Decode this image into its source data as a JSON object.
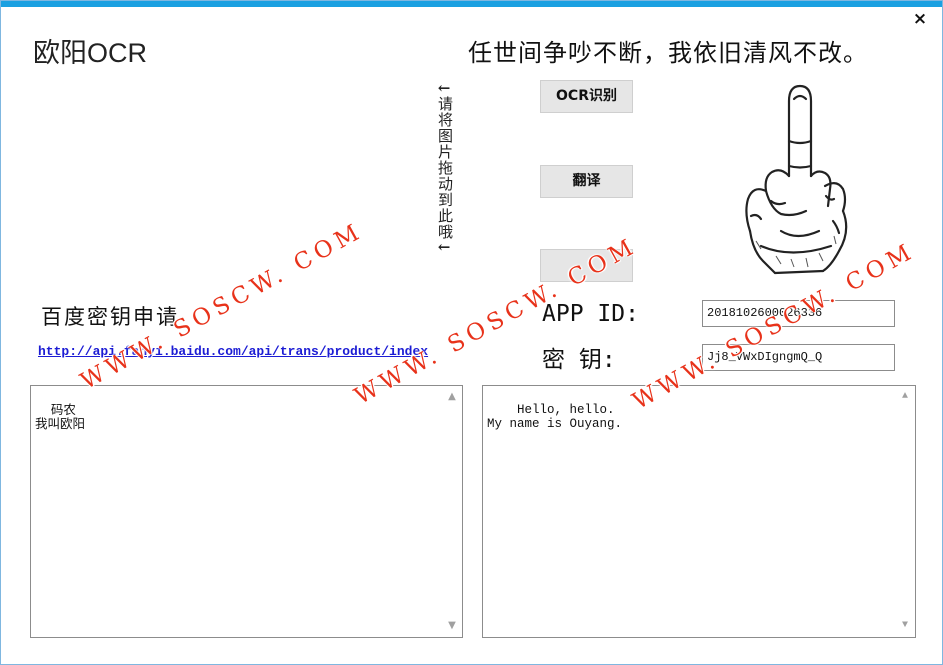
{
  "window": {
    "title": "欧阳OCR",
    "slogan": "任世间争吵不断，我依旧清风不改。",
    "close_label": "×"
  },
  "drop_hint": {
    "arrow_top": "←",
    "text": "请将图片拖动到此哦",
    "arrow_bottom": "←"
  },
  "buttons": {
    "ocr": "OCR识别",
    "translate": "翻译",
    "blank": ""
  },
  "apply": {
    "label": "百度密钥申请",
    "link": "http://api.fanyi.baidu.com/api/trans/product/index"
  },
  "credentials": {
    "appid_label": "APP ID:",
    "appid_value": "2018102600026336",
    "secret_label": "密  钥:",
    "secret_value": "Jj8_VWxDIgngmQ_Q"
  },
  "source_text": "码农\n我叫欧阳",
  "result_text": "Hello, hello.\nMy name is Ouyang.",
  "scroll_icons": {
    "up": "▲",
    "down": "▼"
  },
  "watermark": "WWW. SOSCW. COM",
  "colors": {
    "accent": "#1ba0e1",
    "watermark": "#e8321a",
    "link": "#1c1cd4"
  }
}
